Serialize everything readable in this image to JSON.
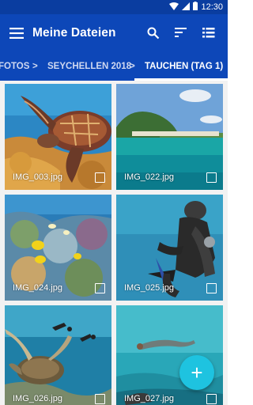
{
  "status": {
    "time": "12:30"
  },
  "appbar": {
    "title": "Meine Dateien",
    "actions": [
      {
        "name": "search-icon"
      },
      {
        "name": "sort-icon"
      },
      {
        "name": "list-view-icon"
      }
    ]
  },
  "breadcrumb": {
    "items": [
      "FOTOS",
      "SEYCHELLEN 2018",
      "TAUCHEN (TAG 1)"
    ],
    "separator": ">"
  },
  "files": [
    {
      "name": "IMG_003.jpg"
    },
    {
      "name": "IMG_022.jpg"
    },
    {
      "name": "IMG_024.jpg"
    },
    {
      "name": "IMG_025.jpg"
    },
    {
      "name": "IMG_026.jpg"
    },
    {
      "name": "IMG_027.jpg"
    }
  ],
  "fab": {
    "label": "+"
  },
  "colors": {
    "appbar": "#0d47b8",
    "statusbar": "#0a3da0",
    "fab": "#1ec3e0"
  }
}
